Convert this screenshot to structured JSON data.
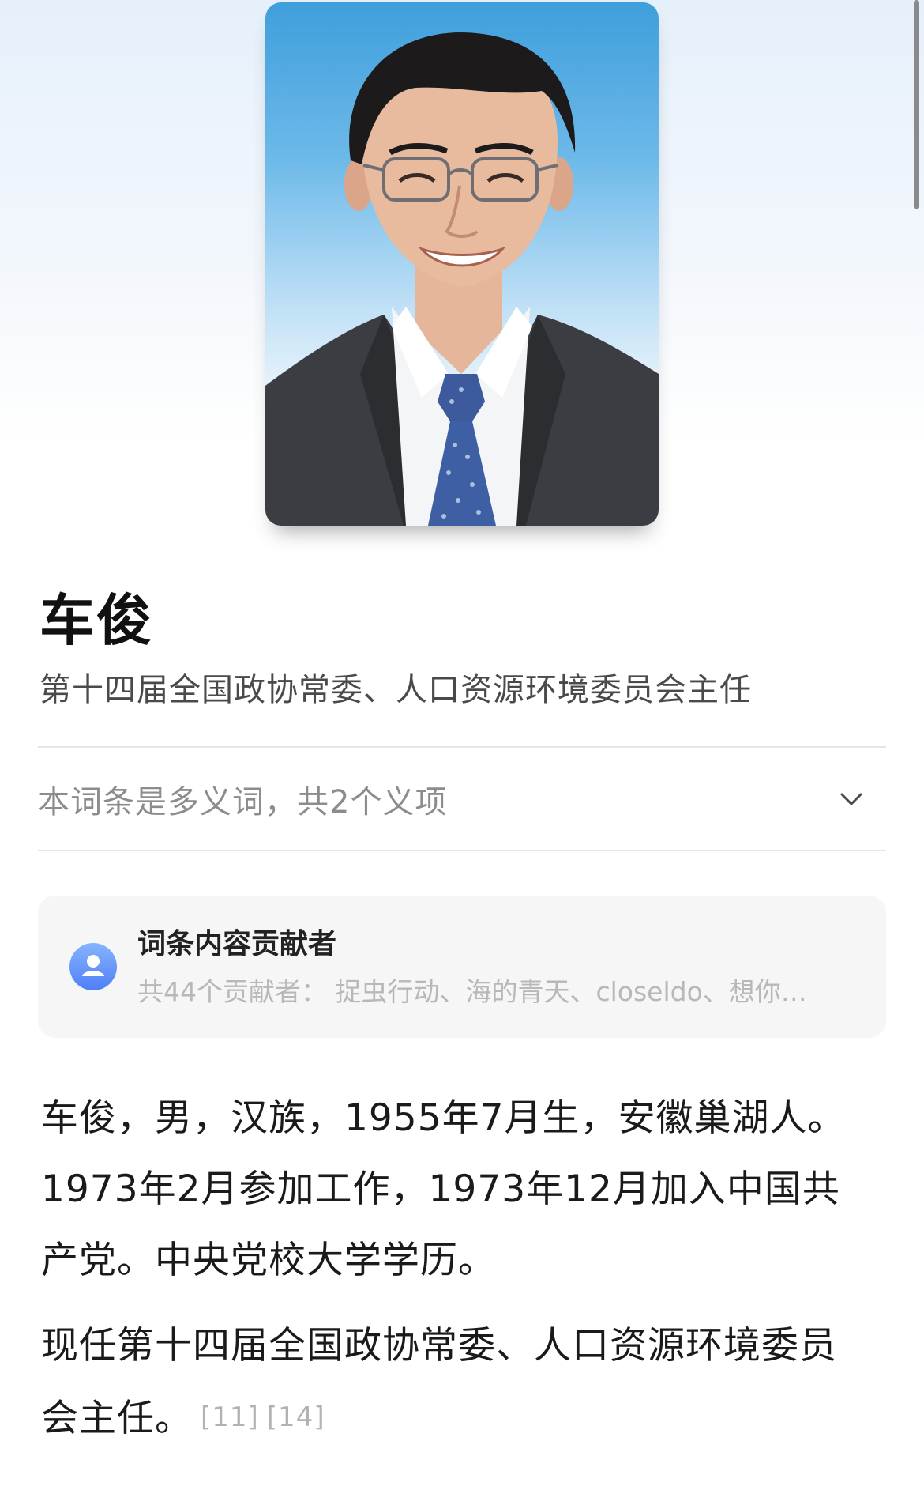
{
  "entry": {
    "name": "车俊",
    "subtitle": "第十四届全国政协常委、人口资源环境委员会主任"
  },
  "polysemy": {
    "text": "本词条是多义词，共2个义项",
    "icon": "chevron-down-icon"
  },
  "contributors": {
    "title": "词条内容贡献者",
    "list": "共44个贡献者：  捉虫行动、海的青天、closeldo、想你…",
    "icon": "user-avatar-icon",
    "accent": "#5b8cff"
  },
  "article": {
    "paragraph1": "车俊，男，汉族，1955年7月生，安徽巢湖人。1973年2月参加工作，1973年12月加入中国共产党。中央党校大学学历。",
    "paragraph2": "现任第十四届全国政协常委、人口资源环境委员会主任。",
    "refs": [
      "[11]",
      "[14]"
    ]
  },
  "colors": {
    "portrait_background": "#4fa8e0",
    "reference": "#b2b2b2",
    "muted_text": "#8c8c8c"
  }
}
